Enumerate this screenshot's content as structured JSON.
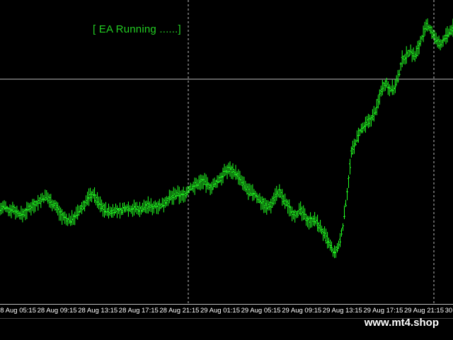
{
  "status_text": "[ EA Running ......]",
  "watermark": "www.mt4.shop",
  "colors": {
    "background": "#000000",
    "candle": "#22ff22",
    "status": "#22cc22",
    "grid_line": "#bdbdbd",
    "axis_text": "#ffffff"
  },
  "time_axis": {
    "labels": [
      "28 Aug 05:15",
      "28 Aug 09:15",
      "28 Aug 13:15",
      "28 Aug 17:15",
      "28 Aug 21:15",
      "29 Aug 01:15",
      "29 Aug 05:15",
      "29 Aug 09:15",
      "29 Aug 13:15",
      "29 Aug 17:15",
      "29 Aug 21:15",
      "30"
    ]
  },
  "chart_data": {
    "type": "line",
    "title": "",
    "series": [
      {
        "values": [
          400,
          402,
          398,
          401,
          396,
          393,
          396,
          402,
          405,
          408,
          412,
          414,
          409,
          404,
          397,
          390,
          386,
          388,
          393,
          399,
          406,
          414,
          418,
          409,
          403,
          398,
          396,
          399,
          397,
          399,
          402,
          400,
          401,
          399,
          402,
          404,
          402,
          405,
          403,
          409,
          412,
          415,
          417,
          415,
          419,
          425,
          427,
          431,
          433,
          428,
          425,
          430,
          436,
          442,
          447,
          445,
          440,
          432,
          425,
          419,
          418,
          412,
          408,
          402,
          405,
          416,
          420,
          410,
          404,
          396,
          394,
          398,
          391,
          386,
          388,
          383,
          375,
          366,
          356,
          347,
          356,
          380,
          420,
          465,
          478,
          490,
          495,
          502,
          508,
          518,
          540,
          548,
          542,
          540,
          552,
          575,
          580,
          585,
          578,
          592,
          605,
          615,
          608,
          597,
          592,
          600,
          605,
          612
        ]
      }
    ],
    "grid": false,
    "legend": "none"
  }
}
